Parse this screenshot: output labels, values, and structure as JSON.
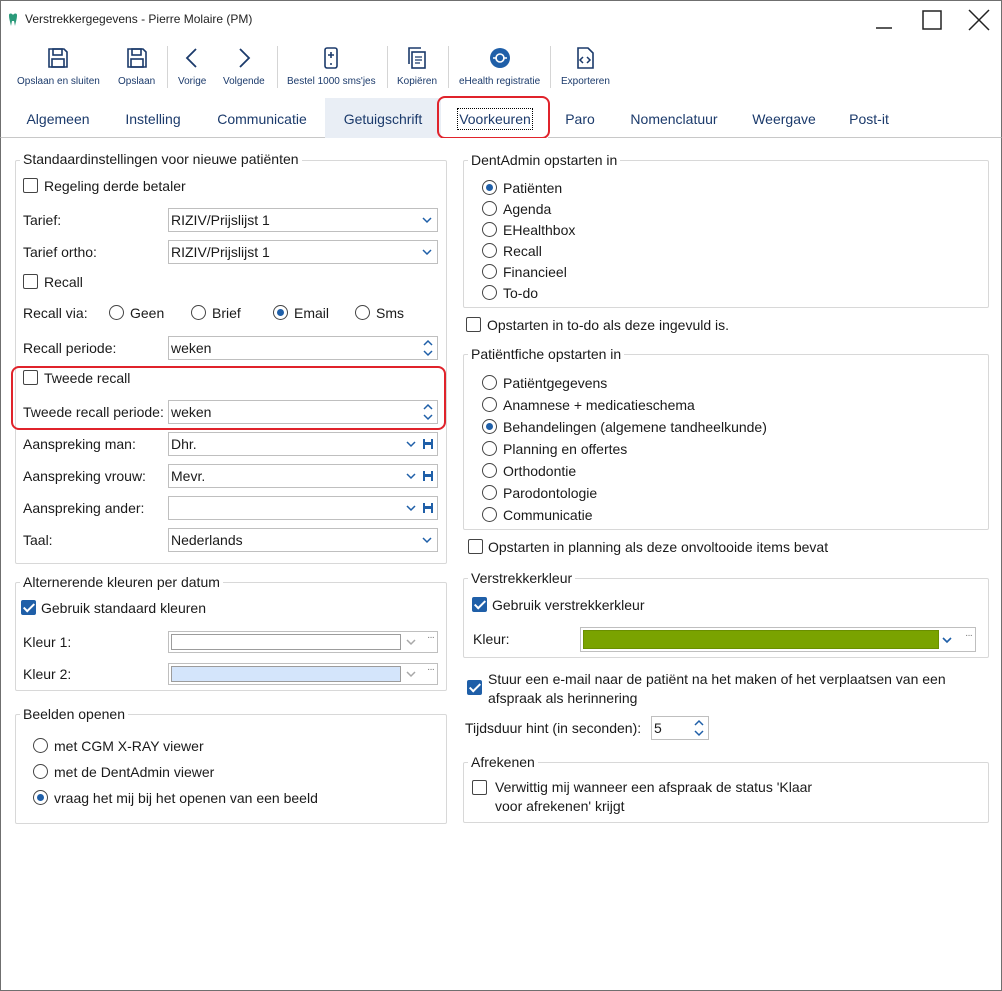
{
  "window": {
    "title": "Verstrekkergegevens - Pierre Molaire (PM)"
  },
  "toolbar": [
    {
      "label": "Opslaan en sluiten",
      "icon": "save-icon"
    },
    {
      "label": "Opslaan",
      "icon": "save-icon"
    },
    {
      "label": "Vorige",
      "icon": "chevron-left-icon"
    },
    {
      "label": "Volgende",
      "icon": "chevron-right-icon"
    },
    {
      "label": "Bestel 1000 sms'jes",
      "icon": "phone-order-icon"
    },
    {
      "label": "Kopiëren",
      "icon": "copy-icon"
    },
    {
      "label": "eHealth registratie",
      "icon": "ehealth-icon"
    },
    {
      "label": "Exporteren",
      "icon": "export-icon"
    }
  ],
  "tabs": [
    "Algemeen",
    "Instelling",
    "Communicatie",
    "Getuigschrift",
    "Voorkeuren",
    "Paro",
    "Nomenclatuur",
    "Weergave",
    "Post-it"
  ],
  "active_tab": "Voorkeuren",
  "left": {
    "defaults": {
      "title": "Standaardinstellingen voor nieuwe patiënten",
      "derde_betaler": {
        "label": "Regeling derde betaler",
        "checked": false
      },
      "tarief": {
        "label": "Tarief:",
        "value": "RIZIV/Prijslijst 1"
      },
      "tarief_ortho": {
        "label": "Tarief ortho:",
        "value": "RIZIV/Prijslijst 1"
      },
      "recall": {
        "label": "Recall",
        "checked": false
      },
      "recall_via": {
        "label": "Recall via:",
        "options": [
          "Geen",
          "Brief",
          "Email",
          "Sms"
        ],
        "selected": "Email"
      },
      "recall_periode": {
        "label": "Recall periode:",
        "value": "weken"
      },
      "tweede_recall": {
        "label": "Tweede recall",
        "checked": false
      },
      "tweede_recall_periode": {
        "label": "Tweede recall periode:",
        "value": "weken"
      },
      "aanspreking_man": {
        "label": "Aanspreking man:",
        "value": "Dhr."
      },
      "aanspreking_vrouw": {
        "label": "Aanspreking vrouw:",
        "value": "Mevr."
      },
      "aanspreking_ander": {
        "label": "Aanspreking ander:",
        "value": ""
      },
      "taal": {
        "label": "Taal:",
        "value": "Nederlands"
      }
    },
    "kleuren": {
      "title": "Alternerende kleuren per datum",
      "gebruik_standaard": {
        "label": "Gebruik standaard kleuren",
        "checked": true
      },
      "kleur1": {
        "label": "Kleur 1:",
        "color": "#ffffff"
      },
      "kleur2": {
        "label": "Kleur 2:",
        "color": "#d4e5fb"
      }
    },
    "beelden": {
      "title": "Beelden openen",
      "options": [
        "met CGM X-RAY viewer",
        "met de DentAdmin viewer",
        "vraag het mij bij het openen van een beeld"
      ],
      "selected": "vraag het mij bij het openen van een beeld"
    }
  },
  "right": {
    "opstarten": {
      "title": "DentAdmin opstarten in",
      "options": [
        "Patiënten",
        "Agenda",
        "EHealthbox",
        "Recall",
        "Financieel",
        "To-do"
      ],
      "selected": "Patiënten"
    },
    "todo_check": {
      "label": "Opstarten in to-do als deze ingevuld is.",
      "checked": false
    },
    "fiche": {
      "title": "Patiëntfiche opstarten in",
      "options": [
        "Patiëntgegevens",
        "Anamnese + medicatieschema",
        "Behandelingen (algemene tandheelkunde)",
        "Planning en offertes",
        "Orthodontie",
        "Parodontologie",
        "Communicatie"
      ],
      "selected": "Behandelingen (algemene tandheelkunde)"
    },
    "planning_check": {
      "label": "Opstarten in planning als deze onvoltooide items bevat",
      "checked": false
    },
    "verstrekkerkleur": {
      "title": "Verstrekkerkleur",
      "gebruik": {
        "label": "Gebruik verstrekkerkleur",
        "checked": true
      },
      "kleur_label": "Kleur:",
      "color": "#7aa300"
    },
    "email_check": {
      "label_line1": "Stuur een e-mail naar de patiënt na het maken of het verplaatsen van een",
      "label_line2": "afspraak als herinnering",
      "checked": true
    },
    "tijdsduur": {
      "label": "Tijdsduur hint (in seconden):",
      "value": "5"
    },
    "afrekenen": {
      "title": "Afrekenen",
      "check": {
        "label_line1": "Verwittig mij wanneer een afspraak de status 'Klaar",
        "label_line2": "voor afrekenen' krijgt",
        "checked": false
      }
    }
  },
  "colors": {
    "accent": "#1f5fa8",
    "highlight": "#e0232b",
    "tab_text": "#1b3a6b"
  }
}
